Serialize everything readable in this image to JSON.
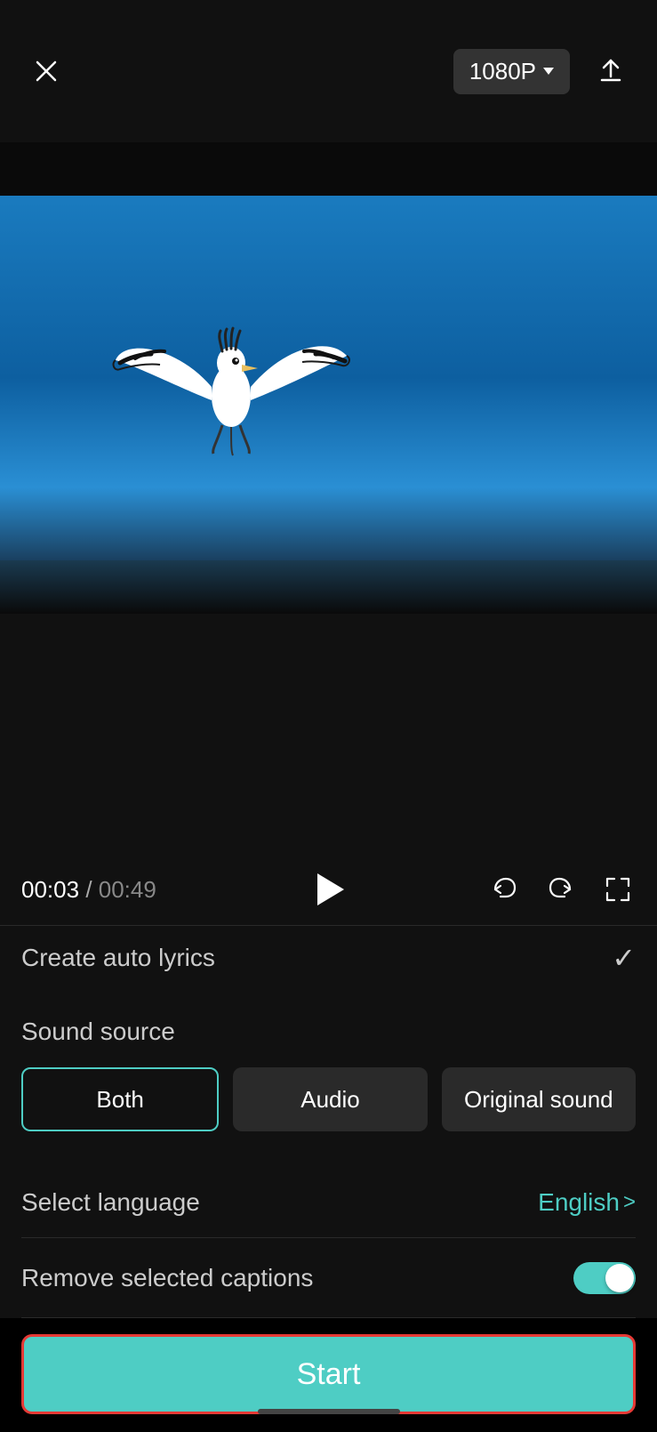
{
  "topbar": {
    "resolution_label": "1080P",
    "close_label": "×"
  },
  "playback": {
    "time_current": "00:03",
    "time_separator": " / ",
    "time_total": "00:49"
  },
  "auto_lyrics": {
    "label": "Create auto lyrics"
  },
  "sound_source": {
    "title": "Sound source",
    "buttons": [
      {
        "id": "both",
        "label": "Both",
        "active": true
      },
      {
        "id": "audio",
        "label": "Audio",
        "active": false
      },
      {
        "id": "original",
        "label": "Original sound",
        "active": false
      }
    ]
  },
  "language": {
    "label": "Select language",
    "value": "English",
    "chevron": ">"
  },
  "remove_captions": {
    "label": "Remove selected captions",
    "toggle_on": true
  },
  "start_button": {
    "label": "Start"
  },
  "icons": {
    "close": "✕",
    "upload": "↑",
    "play": "▶",
    "undo": "↺",
    "redo": "↻",
    "fullscreen": "⛶",
    "check": "✓"
  }
}
